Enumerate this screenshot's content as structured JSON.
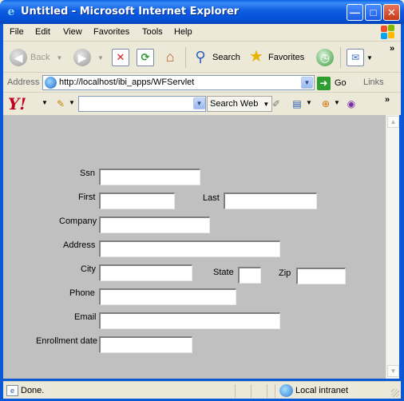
{
  "window": {
    "title": "Untitled - Microsoft Internet Explorer",
    "minimize_glyph": "—",
    "maximize_glyph": "□",
    "close_glyph": "✕"
  },
  "menubar": {
    "items": [
      "File",
      "Edit",
      "View",
      "Favorites",
      "Tools",
      "Help"
    ]
  },
  "toolbar": {
    "back_label": "Back",
    "search_label": "Search",
    "favorites_label": "Favorites"
  },
  "addressbar": {
    "label": "Address",
    "url": "http://localhost/ibi_apps/WFServlet",
    "go_label": "Go",
    "links_label": "Links"
  },
  "yahoobar": {
    "logo": "Y!",
    "search_value": "",
    "search_button_label": "Search Web"
  },
  "form": {
    "ssn": {
      "label": "Ssn",
      "value": ""
    },
    "first": {
      "label": "First",
      "value": ""
    },
    "last": {
      "label": "Last",
      "value": ""
    },
    "company": {
      "label": "Company",
      "value": ""
    },
    "address": {
      "label": "Address",
      "value": ""
    },
    "city": {
      "label": "City",
      "value": ""
    },
    "state": {
      "label": "State",
      "value": ""
    },
    "zip": {
      "label": "Zip",
      "value": ""
    },
    "phone": {
      "label": "Phone",
      "value": ""
    },
    "email": {
      "label": "Email",
      "value": ""
    },
    "enrollment_date": {
      "label": "Enrollment date",
      "value": ""
    }
  },
  "statusbar": {
    "status_text": "Done.",
    "zone_text": "Local intranet"
  },
  "colors": {
    "titlebar": "#0a58d6",
    "page_background": "#c0c0c0",
    "chrome": "#ece9d8",
    "yahoo_red": "#c2001f"
  },
  "icons": {
    "back": "back-arrow-icon",
    "forward": "forward-arrow-icon",
    "stop": "stop-icon",
    "refresh": "refresh-icon",
    "home": "home-icon",
    "search": "magnifier-icon",
    "favorites": "star-icon",
    "history": "history-icon",
    "mail": "mail-icon"
  }
}
